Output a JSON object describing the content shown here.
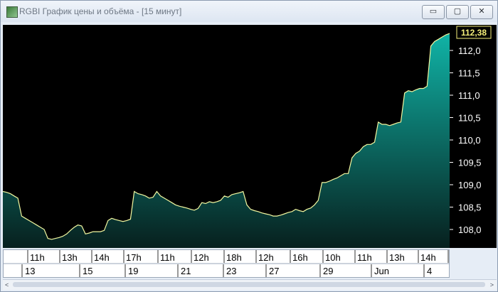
{
  "window": {
    "title": "RGBI График цены и объёма - [15 минут]",
    "controls": {
      "minimize": "▭",
      "maximize": "▢",
      "close": "✕"
    }
  },
  "colors": {
    "background": "#000000",
    "line": "#f2f7a0",
    "fill_top": "#10b3a6",
    "fill_bottom": "#07201e",
    "last_price_box": "#000000",
    "last_price_text": "#f6f07a",
    "axis_text": "#ffffff"
  },
  "chart_data": {
    "type": "area",
    "instrument": "RGBI",
    "y_axis_side": "right",
    "ylim": [
      107.6,
      113.5
    ],
    "y_ticks": [
      "108,0",
      "108,5",
      "109,0",
      "109,5",
      "110,0",
      "110,5",
      "111,0",
      "111,5",
      "112,0"
    ],
    "last_price": "112,38",
    "x_time_labels": [
      "11h",
      "13h",
      "14h",
      "17h",
      "11h",
      "12h",
      "18h",
      "12h",
      "16h",
      "10h",
      "11h",
      "13h",
      "14h",
      "14h"
    ],
    "x_date_labels": [
      "13",
      "15",
      "19",
      "21",
      "23",
      "27",
      "29",
      "Jun",
      "4"
    ],
    "grid": false,
    "values": [
      108.85,
      108.83,
      108.8,
      108.75,
      108.7,
      108.3,
      108.25,
      108.2,
      108.15,
      108.1,
      108.05,
      108.0,
      107.8,
      107.78,
      107.8,
      107.82,
      107.85,
      107.9,
      107.98,
      108.05,
      108.1,
      108.08,
      107.9,
      107.92,
      107.95,
      107.95,
      107.95,
      107.98,
      108.2,
      108.25,
      108.22,
      108.2,
      108.18,
      108.2,
      108.23,
      108.85,
      108.8,
      108.78,
      108.75,
      108.7,
      108.72,
      108.85,
      108.75,
      108.7,
      108.65,
      108.6,
      108.55,
      108.52,
      108.5,
      108.48,
      108.45,
      108.43,
      108.47,
      108.6,
      108.58,
      108.62,
      108.6,
      108.62,
      108.65,
      108.75,
      108.72,
      108.78,
      108.8,
      108.82,
      108.85,
      108.55,
      108.45,
      108.42,
      108.4,
      108.37,
      108.35,
      108.33,
      108.3,
      108.3,
      108.32,
      108.35,
      108.38,
      108.4,
      108.45,
      108.42,
      108.4,
      108.45,
      108.48,
      108.55,
      108.65,
      109.05,
      109.05,
      109.08,
      109.12,
      109.15,
      109.2,
      109.25,
      109.25,
      109.6,
      109.7,
      109.75,
      109.85,
      109.9,
      109.9,
      109.95,
      110.4,
      110.35,
      110.35,
      110.32,
      110.35,
      110.38,
      110.4,
      111.05,
      111.1,
      111.08,
      111.12,
      111.15,
      111.15,
      111.2,
      112.1,
      112.2,
      112.25,
      112.3,
      112.35,
      112.38
    ]
  }
}
